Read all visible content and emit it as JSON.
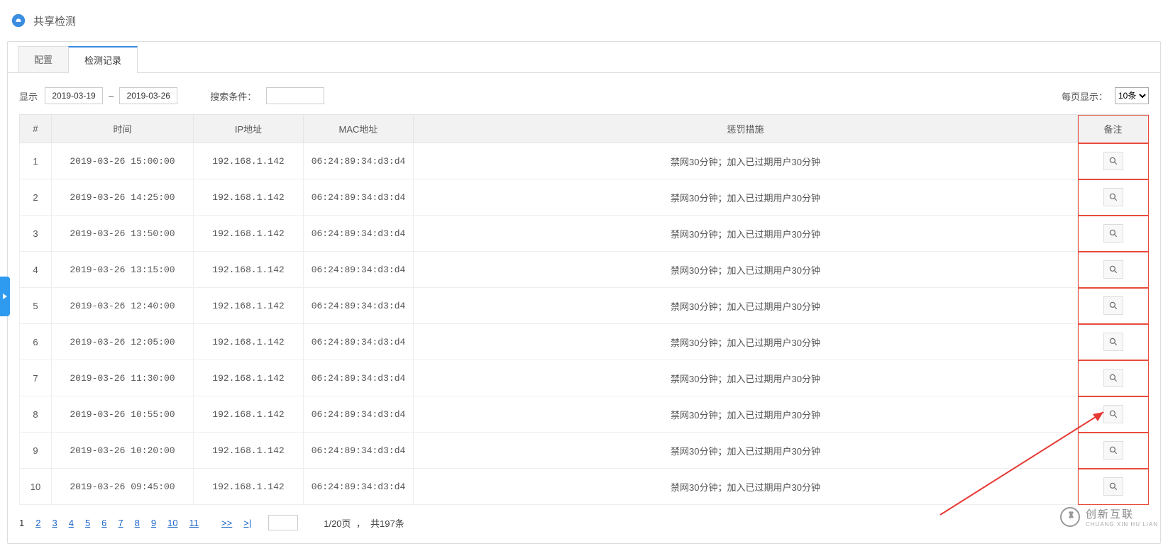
{
  "header": {
    "title": "共享检测"
  },
  "tabs": [
    {
      "label": "配置",
      "active": false
    },
    {
      "label": "检测记录",
      "active": true
    }
  ],
  "filters": {
    "display_label": "显示",
    "date_from": "2019-03-19",
    "date_to": "2019-03-26",
    "search_label": "搜索条件：",
    "search_value": "",
    "per_page_label": "每页显示：",
    "per_page_value": "10条"
  },
  "table": {
    "headers": {
      "idx": "#",
      "time": "时间",
      "ip": "IP地址",
      "mac": "MAC地址",
      "penalty": "惩罚措施",
      "note": "备注"
    },
    "rows": [
      {
        "idx": "1",
        "time": "2019-03-26 15:00:00",
        "ip": "192.168.1.142",
        "mac": "06:24:89:34:d3:d4",
        "penalty": "禁网30分钟；加入已过期用户30分钟"
      },
      {
        "idx": "2",
        "time": "2019-03-26 14:25:00",
        "ip": "192.168.1.142",
        "mac": "06:24:89:34:d3:d4",
        "penalty": "禁网30分钟；加入已过期用户30分钟"
      },
      {
        "idx": "3",
        "time": "2019-03-26 13:50:00",
        "ip": "192.168.1.142",
        "mac": "06:24:89:34:d3:d4",
        "penalty": "禁网30分钟；加入已过期用户30分钟"
      },
      {
        "idx": "4",
        "time": "2019-03-26 13:15:00",
        "ip": "192.168.1.142",
        "mac": "06:24:89:34:d3:d4",
        "penalty": "禁网30分钟；加入已过期用户30分钟"
      },
      {
        "idx": "5",
        "time": "2019-03-26 12:40:00",
        "ip": "192.168.1.142",
        "mac": "06:24:89:34:d3:d4",
        "penalty": "禁网30分钟；加入已过期用户30分钟"
      },
      {
        "idx": "6",
        "time": "2019-03-26 12:05:00",
        "ip": "192.168.1.142",
        "mac": "06:24:89:34:d3:d4",
        "penalty": "禁网30分钟；加入已过期用户30分钟"
      },
      {
        "idx": "7",
        "time": "2019-03-26 11:30:00",
        "ip": "192.168.1.142",
        "mac": "06:24:89:34:d3:d4",
        "penalty": "禁网30分钟；加入已过期用户30分钟"
      },
      {
        "idx": "8",
        "time": "2019-03-26 10:55:00",
        "ip": "192.168.1.142",
        "mac": "06:24:89:34:d3:d4",
        "penalty": "禁网30分钟；加入已过期用户30分钟"
      },
      {
        "idx": "9",
        "time": "2019-03-26 10:20:00",
        "ip": "192.168.1.142",
        "mac": "06:24:89:34:d3:d4",
        "penalty": "禁网30分钟；加入已过期用户30分钟"
      },
      {
        "idx": "10",
        "time": "2019-03-26 09:45:00",
        "ip": "192.168.1.142",
        "mac": "06:24:89:34:d3:d4",
        "penalty": "禁网30分钟；加入已过期用户30分钟"
      }
    ]
  },
  "pagination": {
    "current": "1",
    "pages": [
      "2",
      "3",
      "4",
      "5",
      "6",
      "7",
      "8",
      "9",
      "10",
      "11"
    ],
    "next": ">>",
    "last": ">|",
    "page_input_value": "",
    "summary_left": "1/20页",
    "summary_sep": "，",
    "summary_right": "共197条"
  },
  "watermark": {
    "text": "创新互联",
    "sub": "CHUANG XIN HU LIAN"
  }
}
